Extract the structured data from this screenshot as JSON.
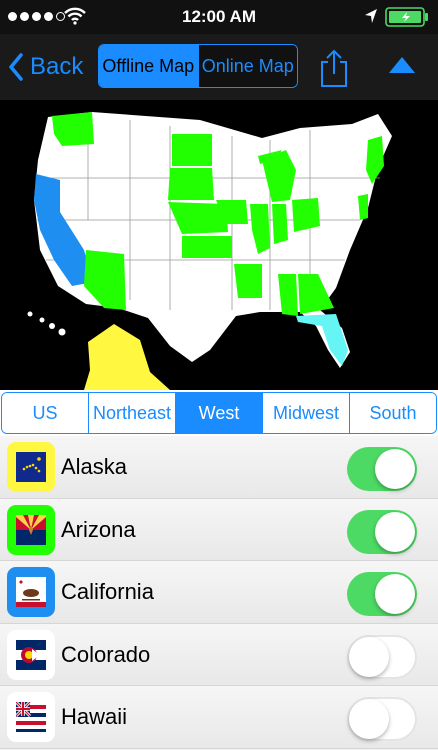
{
  "status_bar": {
    "time": "12:00 AM",
    "signal_dots_filled": 4,
    "signal_dots_total": 5,
    "battery_color": "#4cd964"
  },
  "nav": {
    "back_label": "Back",
    "map_modes": [
      {
        "label": "Offline Map",
        "active": true
      },
      {
        "label": "Online Map",
        "active": false
      }
    ],
    "accent": "#1a8cff"
  },
  "map": {
    "colors": {
      "green": "#22ff00",
      "blue": "#1e8ff0",
      "yellow": "#fff740",
      "cyan": "#66f5f5",
      "white": "#ffffff"
    }
  },
  "regions": [
    {
      "label": "US",
      "active": false
    },
    {
      "label": "Northeast",
      "active": false
    },
    {
      "label": "West",
      "active": true
    },
    {
      "label": "Midwest",
      "active": false
    },
    {
      "label": "South",
      "active": false
    }
  ],
  "states": [
    {
      "name": "Alaska",
      "badge_color": "#fff740",
      "flag": "alaska-flag-icon",
      "enabled": true
    },
    {
      "name": "Arizona",
      "badge_color": "#22ff00",
      "flag": "arizona-flag-icon",
      "enabled": true
    },
    {
      "name": "California",
      "badge_color": "#1e8ff0",
      "flag": "california-flag-icon",
      "enabled": true
    },
    {
      "name": "Colorado",
      "badge_color": "#ffffff",
      "flag": "colorado-flag-icon",
      "enabled": false
    },
    {
      "name": "Hawaii",
      "badge_color": "#ffffff",
      "flag": "hawaii-flag-icon",
      "enabled": false
    }
  ]
}
